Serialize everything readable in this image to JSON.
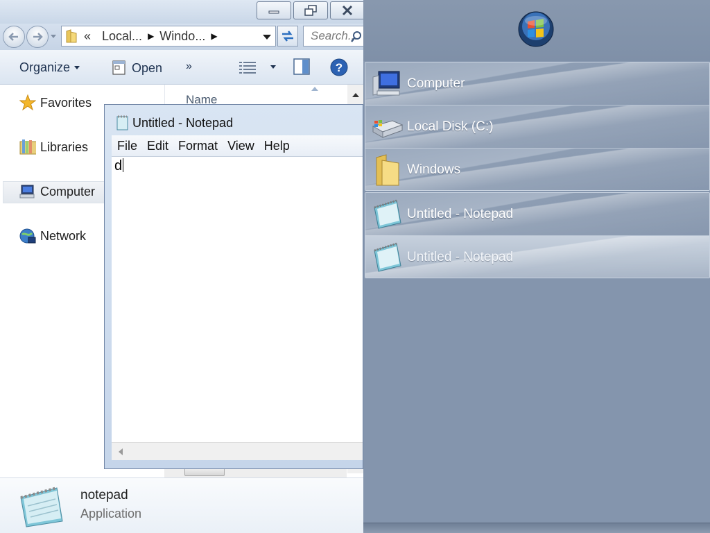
{
  "explorer": {
    "window_controls": {
      "minimize_icon": "minimize-icon",
      "restore_icon": "restore-icon",
      "close_icon": "close-icon"
    },
    "address": {
      "overflow": "«",
      "crumbs": [
        "Local...",
        "Windo..."
      ]
    },
    "search": {
      "placeholder": "Search..."
    },
    "toolbar": {
      "organize": "Organize",
      "open": "Open",
      "more": "»"
    },
    "nav": {
      "favorites": "Favorites",
      "libraries": "Libraries",
      "computer": "Computer",
      "network": "Network"
    },
    "columns": {
      "name": "Name"
    },
    "details": {
      "name": "notepad",
      "type": "Application"
    }
  },
  "notepad": {
    "title": "Untitled - Notepad",
    "menus": [
      "File",
      "Edit",
      "Format",
      "View",
      "Help"
    ],
    "content": "d"
  },
  "switcher": {
    "groups": [
      {
        "items": [
          {
            "label": "Computer",
            "icon": "computer-icon"
          },
          {
            "label": "Local Disk (C:)",
            "icon": "drive-icon"
          },
          {
            "label": "Windows",
            "icon": "folder-icon"
          }
        ]
      },
      {
        "items": [
          {
            "label": "Untitled - Notepad",
            "icon": "notepad-icon"
          },
          {
            "label": "Untitled - Notepad",
            "icon": "notepad-icon",
            "selected": true
          }
        ]
      }
    ]
  },
  "colors": {
    "switcher_bg": "#8495ad",
    "item_text": "#ffffff",
    "explorer_accent": "#1e3250"
  }
}
